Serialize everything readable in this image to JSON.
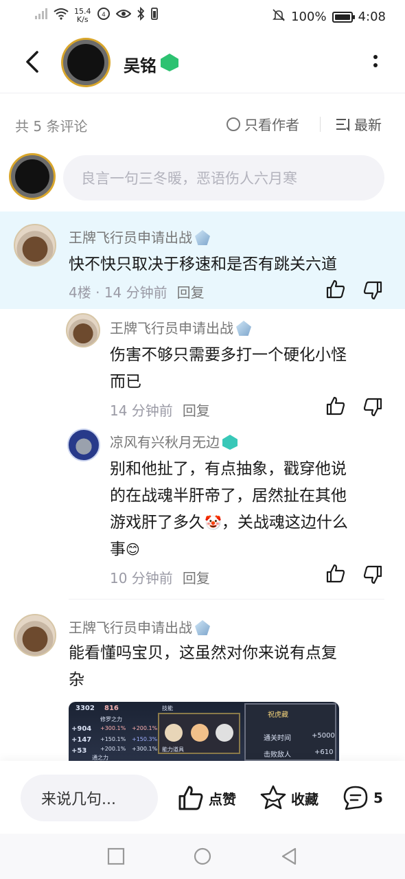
{
  "status_bar": {
    "speed_value": "15.4",
    "speed_unit": "K/s",
    "battery": "100%",
    "battery_level": 1.0,
    "time": "4:08"
  },
  "header": {
    "author_name": "吴铭",
    "back_icon": "chevron-left-icon",
    "more_icon": "more-vertical-icon"
  },
  "comment_bar": {
    "count_text": "共 5 条评论",
    "only_author_label": "只看作者",
    "sort_label": "最新"
  },
  "compose": {
    "placeholder": "良言一句三冬暖，恶语伤人六月寒"
  },
  "comments": [
    {
      "user": "王牌飞行员申请出战",
      "text": "快不快只取决于移速和是否有跳关六道",
      "floor": "4楼",
      "time": "14 分钟前",
      "reply_label": "回复"
    },
    {
      "user": "王牌飞行员申请出战",
      "text_line1": "伤害不够只需要多打一个硬化小怪",
      "text_line2": "而已",
      "time": "14 分钟前",
      "reply_label": "回复"
    },
    {
      "user": "凉风有兴秋月无边",
      "text_line1": "别和他扯了，有点抽象，戳穿他说",
      "text_line2": "的在战魂半肝帝了，居然扯在其他",
      "text_line3": "游戏肝了多久",
      "text_line3b": "，关战魂这边什么",
      "text_line4": "事",
      "time": "10 分钟前",
      "reply_label": "回复"
    },
    {
      "user": "王牌飞行员申请出战",
      "text_line1": "能看懂吗宝贝，这虽然对你来说有点复",
      "text_line2": "杂",
      "image": {
        "stat1": "3302",
        "stat2": "816",
        "label_left": "修罗之力",
        "label_skill": "技能",
        "label_bottom1": "通之力",
        "label_bottom2": "能力道具",
        "right_title": "祝虎藏",
        "right_row1": "通关时间",
        "right_row1_val": "+5000",
        "right_row2": "击败敌人",
        "right_row2_val": "+610",
        "left_vals": [
          "+904",
          "+147",
          "+53"
        ],
        "pct_vals": [
          "+300.1%",
          "+200.1%",
          "+150.1%",
          "+150.3%",
          "+200.1%",
          "+300.1%"
        ]
      }
    }
  ],
  "bottom_bar": {
    "input_placeholder": "来说几句...",
    "like_label": "点赞",
    "collect_label": "收藏",
    "comment_count": "5"
  },
  "colors": {
    "highlight_row": "#e9f7fd",
    "author_badge": "#2dc271",
    "muted_text": "#9a9aa5"
  }
}
